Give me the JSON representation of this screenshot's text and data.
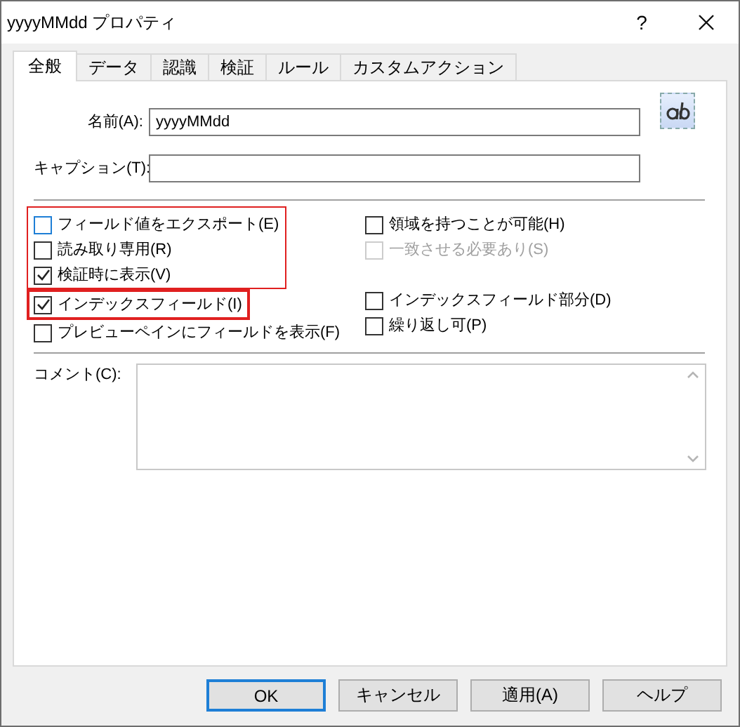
{
  "window": {
    "title": "yyyyMMdd プロパティ",
    "help_button": "?"
  },
  "tabs": [
    {
      "label": "全般",
      "selected": true
    },
    {
      "label": "データ",
      "selected": false
    },
    {
      "label": "認識",
      "selected": false
    },
    {
      "label": "検証",
      "selected": false
    },
    {
      "label": "ルール",
      "selected": false
    },
    {
      "label": "カスタムアクション",
      "selected": false
    }
  ],
  "fields": [
    {
      "label": "名前(A):",
      "value": "yyyyMMdd"
    },
    {
      "label": "キャプション(T):"
    }
  ],
  "left_checkbox_groups": [
    {
      "framed": true,
      "heavy_frame": false,
      "items": [
        {
          "label": "フィールド値をエクスポート(E)",
          "checked": false,
          "disabled": false,
          "color": "#1e7fd6"
        },
        {
          "label": "読み取り専用(R)",
          "checked": false,
          "disabled": false,
          "color": "#333333"
        },
        {
          "label": "検証時に表示(V)",
          "checked": true,
          "disabled": false,
          "color": "#333333"
        }
      ]
    },
    {
      "framed": true,
      "heavy_frame": true,
      "items": [
        {
          "label": "インデックスフィールド(I)",
          "checked": true,
          "disabled": false,
          "color": "#333333"
        }
      ]
    },
    {
      "framed": false,
      "heavy_frame": false,
      "items": [
        {
          "label": "プレビューペインにフィールドを表示(F)",
          "checked": false,
          "disabled": false,
          "color": "#333333"
        }
      ]
    }
  ],
  "right_checkbox_groups": [
    [
      {
        "label": "領域を持つことが可能(H)",
        "checked": false,
        "disabled": false,
        "color": "#333333"
      },
      {
        "label": "一致させる必要あり(S)",
        "checked": false,
        "disabled": true,
        "color": "#cccccc"
      }
    ],
    [
      {
        "label": "インデックスフィールド部分(D)",
        "checked": false,
        "disabled": false,
        "color": "#333333"
      },
      {
        "label": "繰り返し可(P)",
        "checked": false,
        "disabled": false,
        "color": "#333333"
      }
    ]
  ],
  "comment": {
    "label": "コメント(C):"
  },
  "buttons": [
    {
      "label": "OK",
      "default": true
    },
    {
      "label": "キャンセル",
      "default": false
    },
    {
      "label": "適用(A)",
      "default": false
    },
    {
      "label": "ヘルプ",
      "default": false
    }
  ]
}
